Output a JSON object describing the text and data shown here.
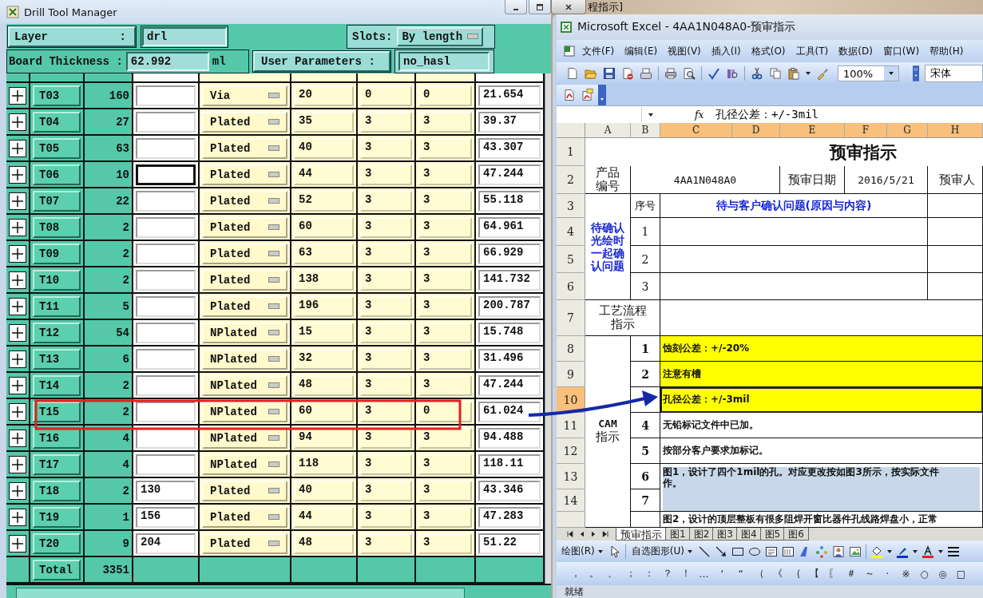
{
  "drill_manager": {
    "title": "Drill Tool Manager",
    "layer_label": "Layer",
    "layer_colon": ":",
    "layer_value": "drl",
    "slots_label": "Slots:",
    "slots_value": "By length",
    "thickness_label": "Board Thickness :",
    "thickness_value": "62.992",
    "thickness_unit": "ml",
    "user_params_label": "User Parameters :",
    "user_params_value": "no_hasl"
  },
  "tools": [
    {
      "name": "T03",
      "count": "160",
      "type": "Via",
      "column_5": "20",
      "column_6": "0",
      "column_7": "0",
      "column_8": "21.654",
      "focused": false
    },
    {
      "name": "T04",
      "count": "27",
      "type": "Plated",
      "column_5": "35",
      "column_6": "3",
      "column_7": "3",
      "column_8": "39.37",
      "focused": false
    },
    {
      "name": "T05",
      "count": "63",
      "type": "Plated",
      "column_5": "40",
      "column_6": "3",
      "column_7": "3",
      "column_8": "43.307",
      "focused": false
    },
    {
      "name": "T06",
      "count": "10",
      "type": "Plated",
      "column_5": "44",
      "column_6": "3",
      "column_7": "3",
      "column_8": "47.244",
      "focused": true
    },
    {
      "name": "T07",
      "count": "22",
      "type": "Plated",
      "column_5": "52",
      "column_6": "3",
      "column_7": "3",
      "column_8": "55.118",
      "focused": false
    },
    {
      "name": "T08",
      "count": "2",
      "type": "Plated",
      "column_5": "60",
      "column_6": "3",
      "column_7": "3",
      "column_8": "64.961",
      "focused": false
    },
    {
      "name": "T09",
      "count": "2",
      "type": "Plated",
      "column_5": "63",
      "column_6": "3",
      "column_7": "3",
      "column_8": "66.929",
      "focused": false
    },
    {
      "name": "T10",
      "count": "2",
      "type": "Plated",
      "column_5": "138",
      "column_6": "3",
      "column_7": "3",
      "column_8": "141.732",
      "focused": false
    },
    {
      "name": "T11",
      "count": "5",
      "type": "Plated",
      "column_5": "196",
      "column_6": "3",
      "column_7": "3",
      "column_8": "200.787",
      "focused": false
    },
    {
      "name": "T12",
      "count": "54",
      "type": "NPlated",
      "column_5": "15",
      "column_6": "3",
      "column_7": "3",
      "column_8": "15.748",
      "focused": false
    },
    {
      "name": "T13",
      "count": "6",
      "type": "NPlated",
      "column_5": "32",
      "column_6": "3",
      "column_7": "3",
      "column_8": "31.496",
      "focused": false
    },
    {
      "name": "T14",
      "count": "2",
      "type": "NPlated",
      "column_5": "48",
      "column_6": "3",
      "column_7": "3",
      "column_8": "47.244",
      "focused": false
    },
    {
      "name": "T15",
      "count": "2",
      "type": "NPlated",
      "column_5": "60",
      "column_6": "3",
      "column_7": "0",
      "column_8": "61.024",
      "focused": false
    },
    {
      "name": "T16",
      "count": "4",
      "type": "NPlated",
      "column_5": "94",
      "column_6": "3",
      "column_7": "3",
      "column_8": "94.488",
      "focused": false
    },
    {
      "name": "T17",
      "count": "4",
      "type": "NPlated",
      "column_5": "118",
      "column_6": "3",
      "column_7": "3",
      "column_8": "118.11",
      "focused": false
    },
    {
      "name": "T18",
      "count": "2",
      "column_3": "130",
      "type": "Plated",
      "column_5": "40",
      "column_6": "3",
      "column_7": "3",
      "column_8": "43.346",
      "focused": false
    },
    {
      "name": "T19",
      "count": "1",
      "column_3": "156",
      "type": "Plated",
      "column_5": "44",
      "column_6": "3",
      "column_7": "3",
      "column_8": "47.283",
      "focused": false
    },
    {
      "name": "T20",
      "count": "9",
      "column_3": "204",
      "type": "Plated",
      "column_5": "48",
      "column_6": "3",
      "column_7": "3",
      "column_8": "51.22",
      "focused": false
    }
  ],
  "total": {
    "label": "Total",
    "count": "3351"
  },
  "background_window": {
    "title": "程指示]"
  },
  "excel": {
    "title": "Microsoft Excel - 4AA1N048A0-预审指示",
    "menu": [
      "文件(F)",
      "编辑(E)",
      "视图(V)",
      "插入(I)",
      "格式(O)",
      "工具(T)",
      "数据(D)",
      "窗口(W)",
      "帮助(H)"
    ],
    "zoom": "100%",
    "font": "宋体",
    "fx": "fx",
    "formula": "孔径公差：+/-3mil",
    "columns": [
      {
        "label": "A",
        "selected": false
      },
      {
        "label": "B",
        "selected": false
      },
      {
        "label": "C",
        "selected": true
      },
      {
        "label": "D",
        "selected": true
      },
      {
        "label": "E",
        "selected": true
      },
      {
        "label": "F",
        "selected": true
      },
      {
        "label": "G",
        "selected": true
      },
      {
        "label": "H",
        "selected": true
      }
    ],
    "rows": [
      {
        "label": "1",
        "selected": false
      },
      {
        "label": "2",
        "selected": false
      },
      {
        "label": "3",
        "selected": false
      },
      {
        "label": "4",
        "selected": false
      },
      {
        "label": "5",
        "selected": false
      },
      {
        "label": "6",
        "selected": false
      },
      {
        "label": "7",
        "selected": false
      },
      {
        "label": "8",
        "selected": false
      },
      {
        "label": "9",
        "selected": false
      },
      {
        "label": "10",
        "selected": true
      },
      {
        "label": "11",
        "selected": false
      },
      {
        "label": "12",
        "selected": false
      },
      {
        "label": "13",
        "selected": false
      },
      {
        "label": "14",
        "selected": false
      }
    ],
    "sheet": {
      "title": "预审指示",
      "product_label": [
        "产品",
        "编号"
      ],
      "product_no": "4AA1N048A0",
      "date_label": "预审日期",
      "date": "2016/5/21",
      "reviewer_label": "预审人",
      "pending_label": [
        "待确认",
        "光绘时",
        "一起确",
        "认问题"
      ],
      "seq_label": "序号",
      "question_header": "待与客户确认问题(原因与内容)",
      "question_numbers": [
        "1",
        "2",
        "3"
      ],
      "process_label": [
        "工艺流程",
        "指示"
      ],
      "cam_label": [
        "CAM",
        "指示"
      ],
      "instructions": [
        {
          "number": "1",
          "text": "蚀刻公差：+/-20%",
          "highlighted": true,
          "selected": false
        },
        {
          "number": "2",
          "text": "注意有槽",
          "highlighted": true,
          "selected": false
        },
        {
          "text": "孔径公差：+/-3mil",
          "highlighted": true,
          "selected": true
        },
        {
          "number": "4",
          "text": "无铅标记文件中已加。",
          "highlighted": false,
          "selected": false
        },
        {
          "number": "5",
          "text": "按部分客户要求加标记。",
          "highlighted": false,
          "selected": false
        }
      ],
      "merged_instruction": {
        "numbers": [
          "6",
          "7"
        ],
        "lines": [
          "图1，设计了四个1mil的孔。对应更改按如图3所示，按实际文件",
          "作。"
        ]
      },
      "cut_instruction": "图2，设计的顶层整板有很多阻焊开窗比器件孔线路焊盘小，正常"
    },
    "sheet_tabs": [
      {
        "label": "预审指示",
        "selected": true
      },
      {
        "label": "图1",
        "selected": false
      },
      {
        "label": "图2",
        "selected": false
      },
      {
        "label": "图3",
        "selected": false
      },
      {
        "label": "图4",
        "selected": false
      },
      {
        "label": "图5",
        "selected": false
      },
      {
        "label": "图6",
        "selected": false
      }
    ],
    "draw_menu": "绘图(R)",
    "autoshapes_menu": "自选图形(U)",
    "symbols": [
      "，",
      "。",
      "、",
      "；",
      "：",
      "？",
      "！",
      "…",
      "‘",
      "“",
      "（",
      "《",
      "｛",
      "【",
      "〖",
      "＃",
      "～",
      "·",
      "※",
      "○",
      "◎",
      "□"
    ],
    "status": "就绪"
  }
}
